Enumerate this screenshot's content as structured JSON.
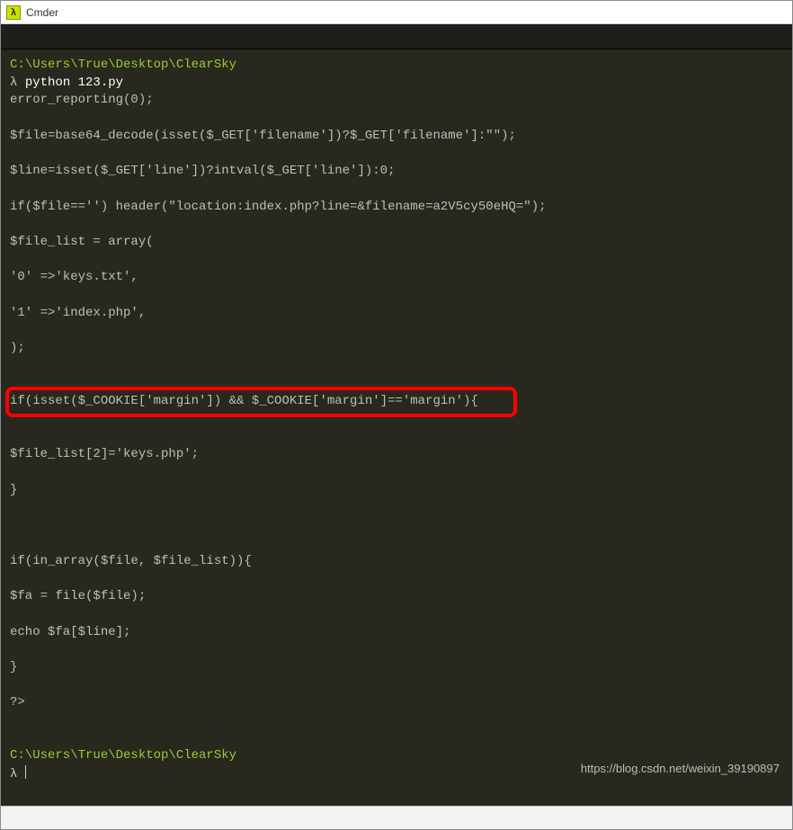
{
  "window": {
    "title": "Cmder",
    "icon_glyph": "λ"
  },
  "session": {
    "prompt_path": "C:\\Users\\True\\Desktop\\ClearSky",
    "prompt_symbol": "λ",
    "command": "python 123.py",
    "output_lines": [
      "error_reporting(0);",
      "",
      "$file=base64_decode(isset($_GET['filename'])?$_GET['filename']:\"\");",
      "",
      "$line=isset($_GET['line'])?intval($_GET['line']):0;",
      "",
      "if($file=='') header(\"location:index.php?line=&filename=a2V5cy50eHQ=\");",
      "",
      "$file_list = array(",
      "",
      "'0' =>'keys.txt',",
      "",
      "'1' =>'index.php',",
      "",
      ");",
      "",
      ""
    ],
    "highlighted_line": "if(isset($_COOKIE['margin']) && $_COOKIE['margin']=='margin'){",
    "output_lines_after": [
      "",
      "$file_list[2]='keys.php';",
      "",
      "}",
      "",
      "",
      "",
      "if(in_array($file, $file_list)){",
      "",
      "$fa = file($file);",
      "",
      "echo $fa[$line];",
      "",
      "}",
      "",
      "?>",
      "",
      "",
      ""
    ],
    "prompt2_path": "C:\\Users\\True\\Desktop\\ClearSky",
    "prompt2_symbol": "λ"
  },
  "watermark": "https://blog.csdn.net/weixin_39190897"
}
